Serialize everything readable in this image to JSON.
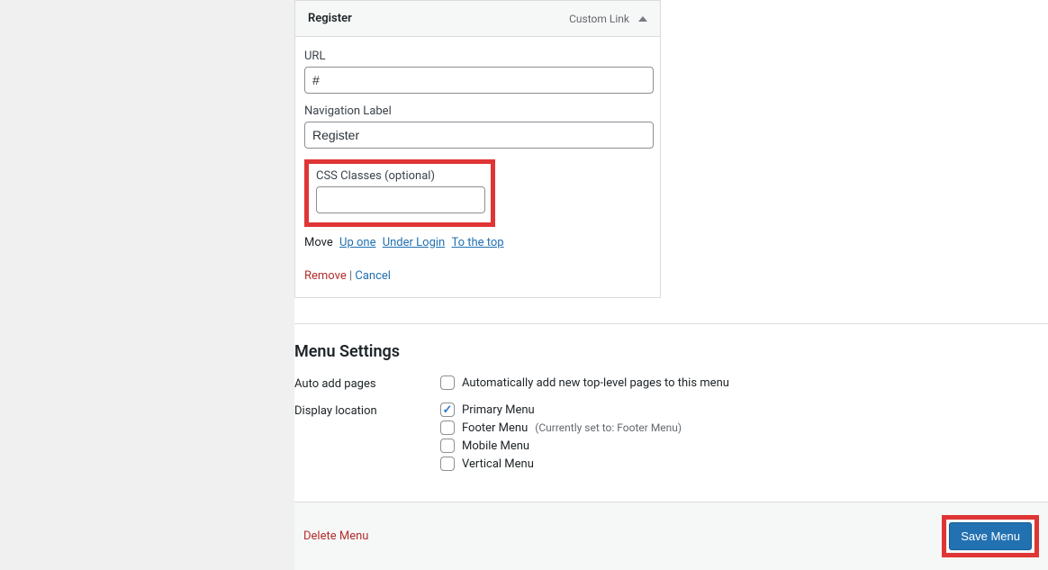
{
  "menu_item": {
    "title": "Register",
    "type": "Custom Link",
    "url_label": "URL",
    "url_value": "#",
    "nav_label_label": "Navigation Label",
    "nav_label_value": "Register",
    "css_label": "CSS Classes (optional)",
    "css_value": "",
    "move_label": "Move",
    "move_up": "Up one",
    "move_under": "Under Login",
    "move_top": "To the top",
    "remove": "Remove",
    "cancel": "Cancel"
  },
  "settings": {
    "heading": "Menu Settings",
    "auto_add_label": "Auto add pages",
    "auto_add_text": "Automatically add new top-level pages to this menu",
    "display_loc_label": "Display location",
    "locations": [
      {
        "label": "Primary Menu",
        "checked": true,
        "note": ""
      },
      {
        "label": "Footer Menu",
        "checked": false,
        "note": "(Currently set to: Footer Menu)"
      },
      {
        "label": "Mobile Menu",
        "checked": false,
        "note": ""
      },
      {
        "label": "Vertical Menu",
        "checked": false,
        "note": ""
      }
    ]
  },
  "footer": {
    "delete": "Delete Menu",
    "save": "Save Menu"
  }
}
